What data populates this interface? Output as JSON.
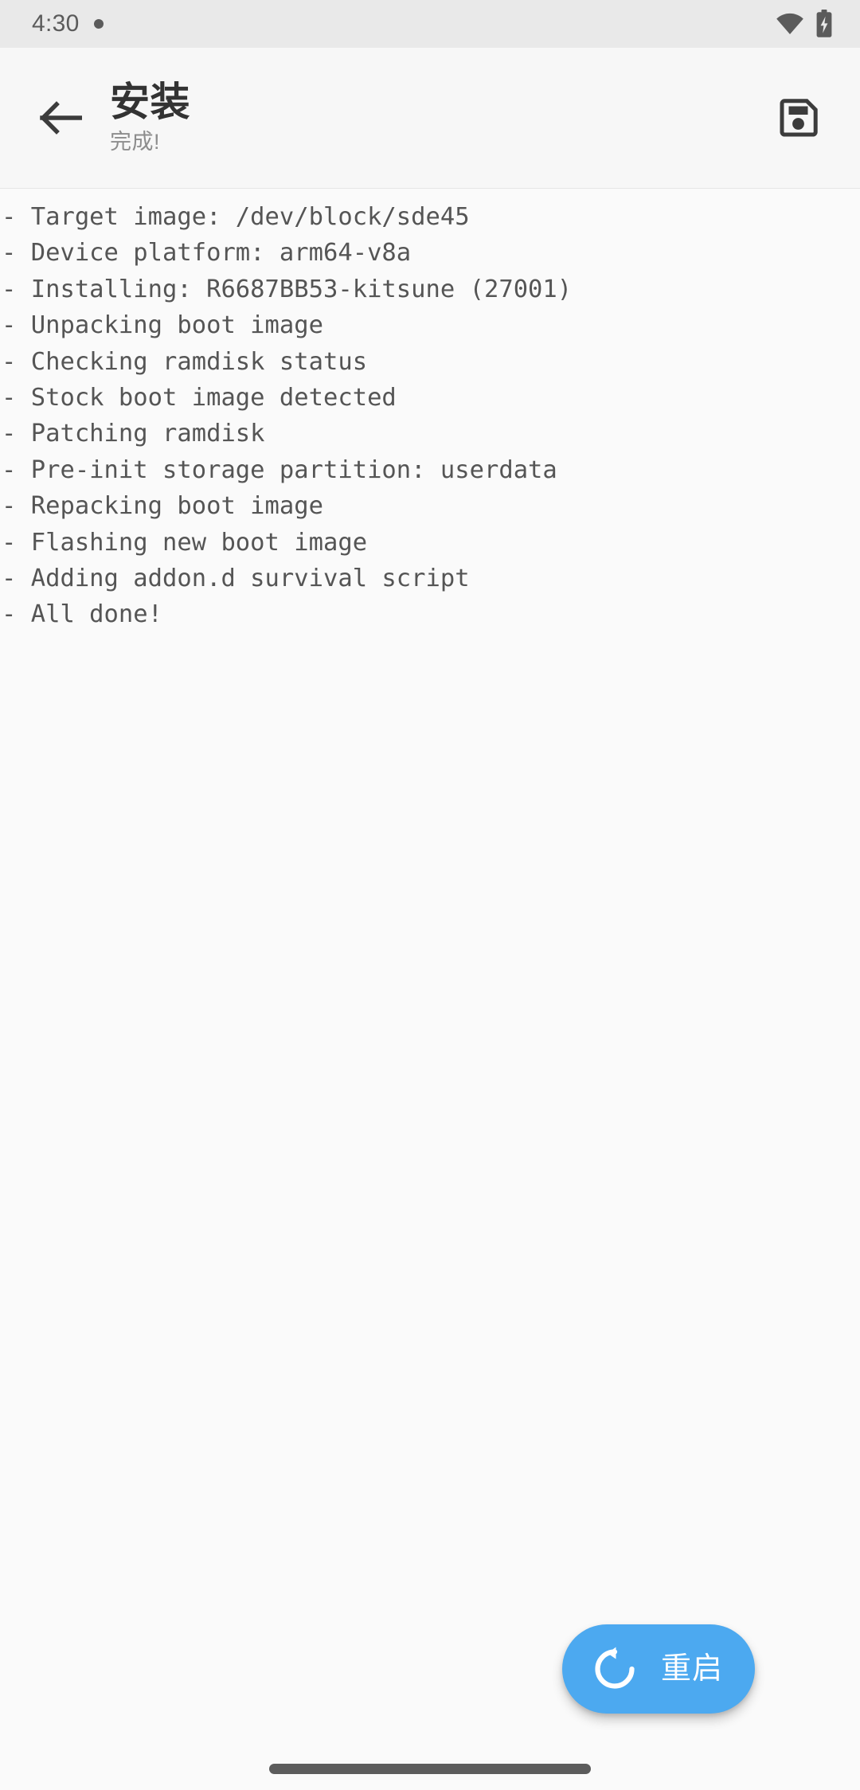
{
  "status_bar": {
    "time": "4:30",
    "notification_dot": "notification-dot",
    "wifi_icon": "wifi-icon",
    "battery_icon": "battery-charging-icon"
  },
  "app_bar": {
    "back_icon": "arrow-left-icon",
    "title": "安装",
    "subtitle": "完成!",
    "save_icon": "floppy-disk-save-icon"
  },
  "log": {
    "lines": [
      "- Target image: /dev/block/sde45",
      "- Device platform: arm64-v8a",
      "- Installing: R6687BB53-kitsune (27001)",
      "- Unpacking boot image",
      "- Checking ramdisk status",
      "- Stock boot image detected",
      "- Patching ramdisk",
      "- Pre-init storage partition: userdata",
      "- Repacking boot image",
      "- Flashing new boot image",
      "- Adding addon.d survival script",
      "- All done!"
    ]
  },
  "fab": {
    "label": "重启",
    "icon": "restart-rotate-icon",
    "color": "#4ca9f0"
  },
  "nav_bar": {
    "gesture_pill": "gesture-home-pill"
  },
  "colors": {
    "status_bar_bg": "#e9e9e9",
    "app_bar_bg": "#f7f7f7",
    "page_bg": "#fafafa",
    "log_text": "#555555",
    "title_text": "#333333",
    "subtitle_text": "#8d8d8d",
    "accent": "#4ca9f0"
  }
}
